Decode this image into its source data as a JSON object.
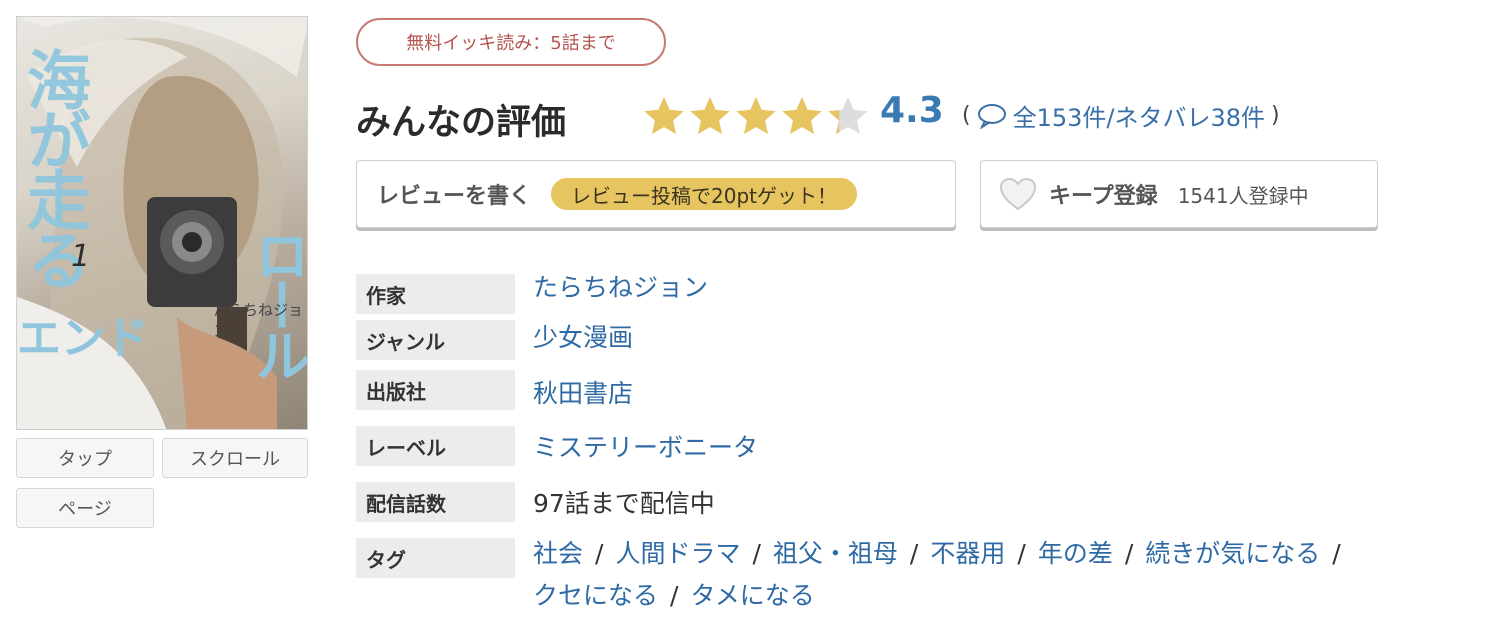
{
  "cover": {
    "title_vertical": "海が走る",
    "title_horizontal": "エンド",
    "title_vertical2": "ロール",
    "volume": "1",
    "author": "たらちねジョン"
  },
  "view_buttons": [
    "タップ",
    "スクロール",
    "ページ"
  ],
  "badge": "無料イッキ読み：5話まで",
  "rating": {
    "title": "みんなの評価",
    "score": "4.3",
    "stars_filled": 4.3,
    "open_paren": "(",
    "reviews": "全153件/ネタバレ38件",
    "close_paren": ")",
    "star_color": "#e6c45f",
    "star_empty_color": "#dddddd"
  },
  "review_button": {
    "label": "レビューを書く",
    "promo": "レビュー投稿で20ptゲット！"
  },
  "keep_button": {
    "label": "キープ登録",
    "count": "1541人登録中"
  },
  "info": {
    "author_label": "作家",
    "author_value": "たらちねジョン",
    "genre_label": "ジャンル",
    "genre_value": "少女漫画",
    "publisher_label": "出版社",
    "publisher_value": "秋田書店",
    "label_label": "レーベル",
    "label_value": "ミステリーボニータ",
    "episodes_label": "配信話数",
    "episodes_value": "97話まで配信中",
    "tags_label": "タグ",
    "tags": [
      "社会",
      "人間ドラマ",
      "祖父・祖母",
      "不器用",
      "年の差",
      "続きが気になる",
      "クセになる",
      "タメになる"
    ]
  }
}
